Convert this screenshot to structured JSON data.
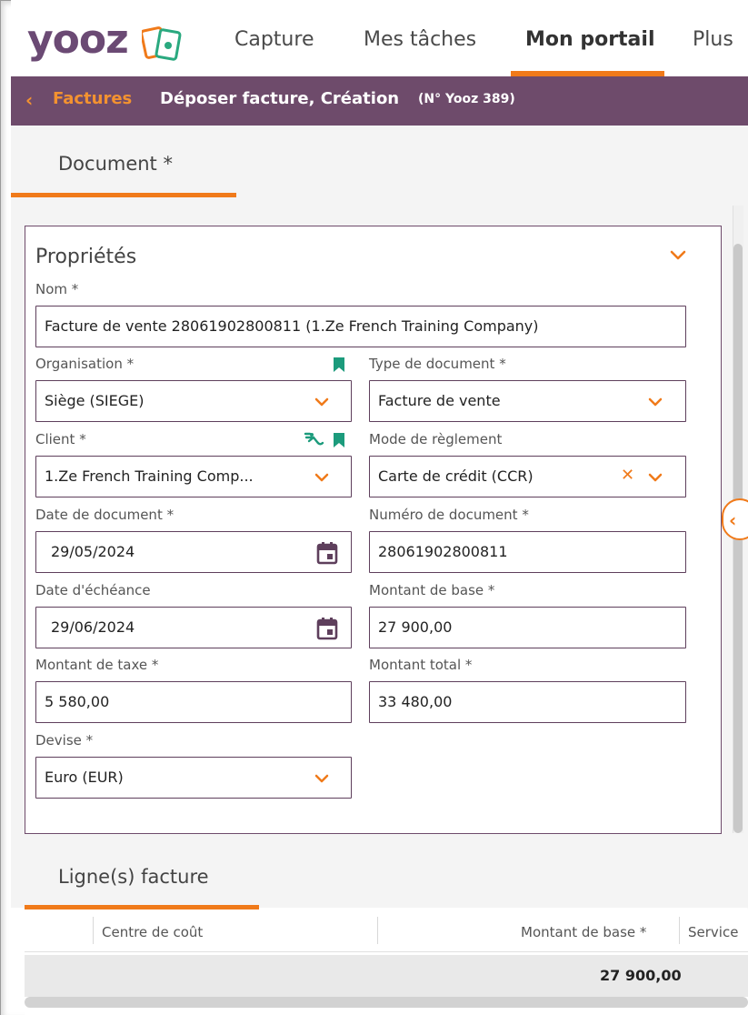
{
  "app": {
    "logo_text": "yooz",
    "nav": [
      "Capture",
      "Mes tâches",
      "Mon portail",
      "Plus"
    ],
    "active_nav": "Mon portail"
  },
  "breadcrumb": {
    "back_label": "Factures",
    "title": "Déposer facture, Création",
    "yooz_number": "(N° Yooz 389)"
  },
  "document_tab": "Document *",
  "properties": {
    "title": "Propriétés",
    "nom": {
      "label": "Nom *",
      "value": "Facture de vente 28061902800811 (1.Ze French Training Company)"
    },
    "organisation": {
      "label": "Organisation *",
      "value": "Siège (SIEGE)"
    },
    "type_document": {
      "label": "Type de document *",
      "value": "Facture de vente"
    },
    "client": {
      "label": "Client *",
      "value": "1.Ze French Training Comp..."
    },
    "mode_reglement": {
      "label": "Mode de règlement",
      "value": "Carte de crédit (CCR)"
    },
    "date_document": {
      "label": "Date de document *",
      "value": "29/05/2024"
    },
    "numero_document": {
      "label": "Numéro de document *",
      "value": "28061902800811"
    },
    "date_echeance": {
      "label": "Date d'échéance",
      "value": "29/06/2024"
    },
    "montant_base": {
      "label": "Montant de base *",
      "value": "27 900,00"
    },
    "montant_taxe": {
      "label": "Montant de taxe *",
      "value": "5 580,00"
    },
    "montant_total": {
      "label": "Montant total *",
      "value": "33 480,00"
    },
    "devise": {
      "label": "Devise *",
      "value": "Euro (EUR)"
    }
  },
  "invoice_lines": {
    "title": "Ligne(s) facture",
    "columns": [
      "Centre de coût",
      "Montant de base *",
      "Service"
    ],
    "total_base": "27 900,00"
  },
  "colors": {
    "brand_purple": "#6e4b6b",
    "accent_orange": "#f07a1a",
    "teal_icon": "#1c9b7c"
  }
}
